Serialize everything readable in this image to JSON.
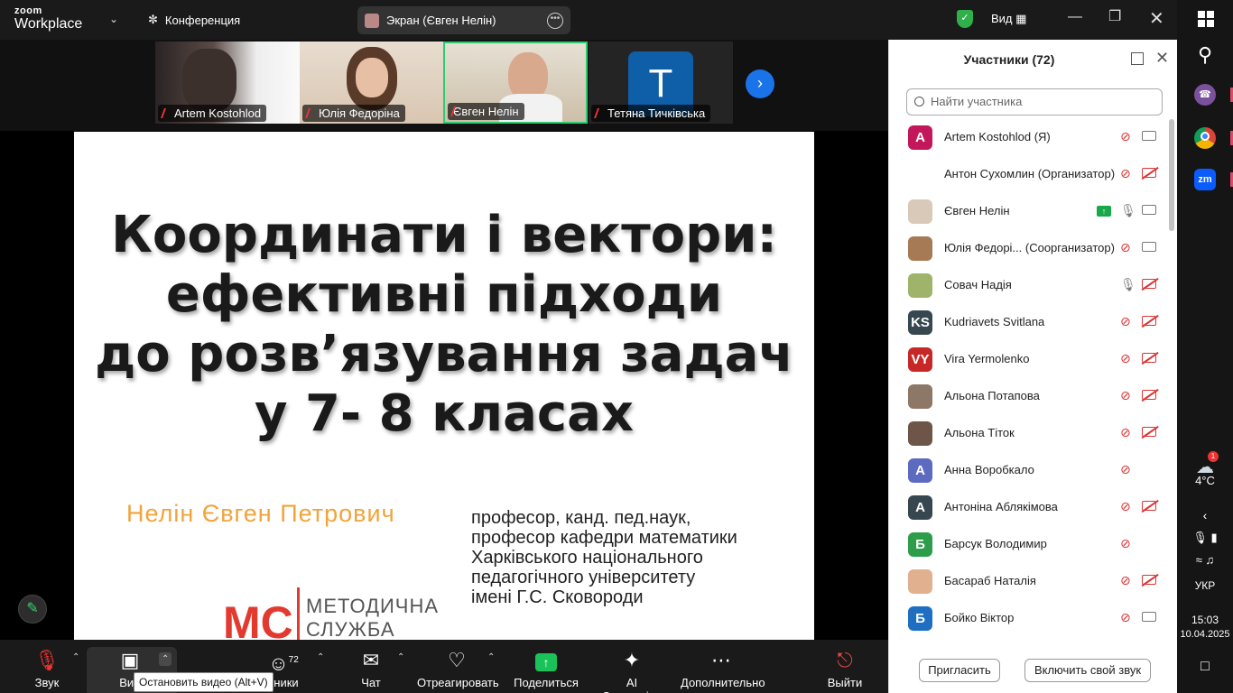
{
  "topbar": {
    "logo_line1": "zoom",
    "logo_line2": "Workplace",
    "meeting_label": "Конференция",
    "screen_share_label": "Экран (Євген Нелін)",
    "view_label": "Вид"
  },
  "thumbnails": [
    {
      "name": "Artem Kostohlod"
    },
    {
      "name": "Юлія Федоріна"
    },
    {
      "name": "Євген Нелін"
    },
    {
      "name": "Тетяна Тичківська",
      "initial": "T"
    }
  ],
  "slide": {
    "title_lines": [
      "Координати і вектори:",
      "ефективні підходи",
      "до розв’язування задач",
      "у 7- 8 класах"
    ],
    "author": "Нелін Євген Петрович",
    "rank": "професор, канд. пед.наук,\nпрофесор кафедри математики\nХарківського національного\nпедагогічного університету\nімені Г.С. Сковороди",
    "logo_line1": "МЕТОДИЧНА",
    "logo_line2": "СЛУЖБА",
    "logo_mark": "МС"
  },
  "toolbar": {
    "audio_label": "Звук",
    "video_label": "Вид",
    "participants_label": "тники",
    "participants_count": "72",
    "chat_label": "Чат",
    "react_label": "Отреагировать",
    "share_label": "Поделиться",
    "ai_label": "AI Companion",
    "more_label": "Дополнительно",
    "exit_label": "Выйти",
    "tooltip": "Остановить видео (Alt+V)"
  },
  "panel": {
    "title": "Участники (72)",
    "search_placeholder": "Найти участника",
    "participants": [
      {
        "name": "Artem Kostohlod (Я)",
        "initials": "A",
        "color": "#c2185b",
        "mic": "muted",
        "cam": "on"
      },
      {
        "name": "Антон Сухомлин (Организатор)",
        "initials": "",
        "color": "#ffffff",
        "mic": "muted",
        "cam": "off"
      },
      {
        "name": "Євген Нелін",
        "initials": "",
        "color": "#d9c9b8",
        "mic": "on",
        "cam": "on",
        "sharing": true
      },
      {
        "name": "Юлія Федорі... (Соорганизатор)",
        "initials": "",
        "color": "#a57a55",
        "mic": "muted",
        "cam": "on"
      },
      {
        "name": "Совач Надія",
        "initials": "",
        "color": "#9fb36a",
        "mic": "on",
        "cam": "off"
      },
      {
        "name": "Kudriavets Svitlana",
        "initials": "KS",
        "color": "#37474f",
        "mic": "muted",
        "cam": "off"
      },
      {
        "name": "Vira Yermolenko",
        "initials": "VY",
        "color": "#c62828",
        "mic": "muted",
        "cam": "off"
      },
      {
        "name": "Альона Потапова",
        "initials": "",
        "color": "#8d7766",
        "mic": "muted",
        "cam": "off"
      },
      {
        "name": "Альона Тіток",
        "initials": "",
        "color": "#6d5548",
        "mic": "muted",
        "cam": "off"
      },
      {
        "name": "Анна Воробкало",
        "initials": "А",
        "color": "#5c6bc0",
        "mic": "muted",
        "cam": "none"
      },
      {
        "name": "Антоніна Аблякімова",
        "initials": "А",
        "color": "#37474f",
        "mic": "muted",
        "cam": "off"
      },
      {
        "name": "Барсук Володимир",
        "initials": "Б",
        "color": "#2e9d4a",
        "mic": "muted",
        "cam": "none"
      },
      {
        "name": "Басараб Наталія",
        "initials": "",
        "color": "#e0b08f",
        "mic": "muted",
        "cam": "off"
      },
      {
        "name": "Бойко Віктор",
        "initials": "Б",
        "color": "#1e6fc2",
        "mic": "muted",
        "cam": "on"
      }
    ],
    "invite_label": "Пригласить",
    "unmute_label": "Включить свой звук"
  },
  "taskbar": {
    "temperature": "4°C",
    "weather_badge": "1",
    "lang": "УКР",
    "time": "15:03",
    "date": "10.04.2025"
  }
}
